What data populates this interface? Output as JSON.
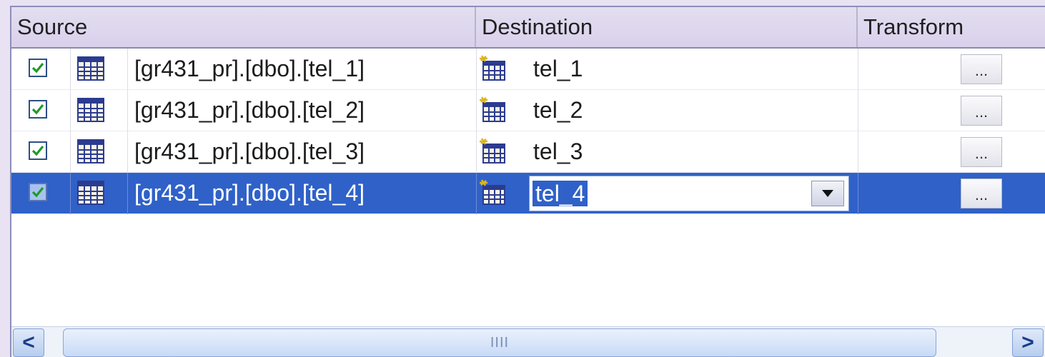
{
  "columns": {
    "source": "Source",
    "destination": "Destination",
    "transform": "Transform"
  },
  "rows": [
    {
      "checked": true,
      "source": "[gr431_pr].[dbo].[tel_1]",
      "destination": "tel_1",
      "transform_btn": "...",
      "selected": false
    },
    {
      "checked": true,
      "source": "[gr431_pr].[dbo].[tel_2]",
      "destination": "tel_2",
      "transform_btn": "...",
      "selected": false
    },
    {
      "checked": true,
      "source": "[gr431_pr].[dbo].[tel_3]",
      "destination": "tel_3",
      "transform_btn": "...",
      "selected": false
    },
    {
      "checked": true,
      "source": "[gr431_pr].[dbo].[tel_4]",
      "destination": "tel_4",
      "transform_btn": "...",
      "selected": true
    }
  ],
  "scrollbar": {
    "left_arrow": "<",
    "right_arrow": ">",
    "grip": "IIII"
  },
  "icons": {
    "checkbox": "checkbox-checked-icon",
    "source_table": "table-icon",
    "destination_table": "new-table-icon",
    "dropdown": "chevron-down-icon"
  },
  "colors": {
    "selection": "#2f61c8",
    "header": "#ddd6ee",
    "frame": "#e9e2f2"
  }
}
